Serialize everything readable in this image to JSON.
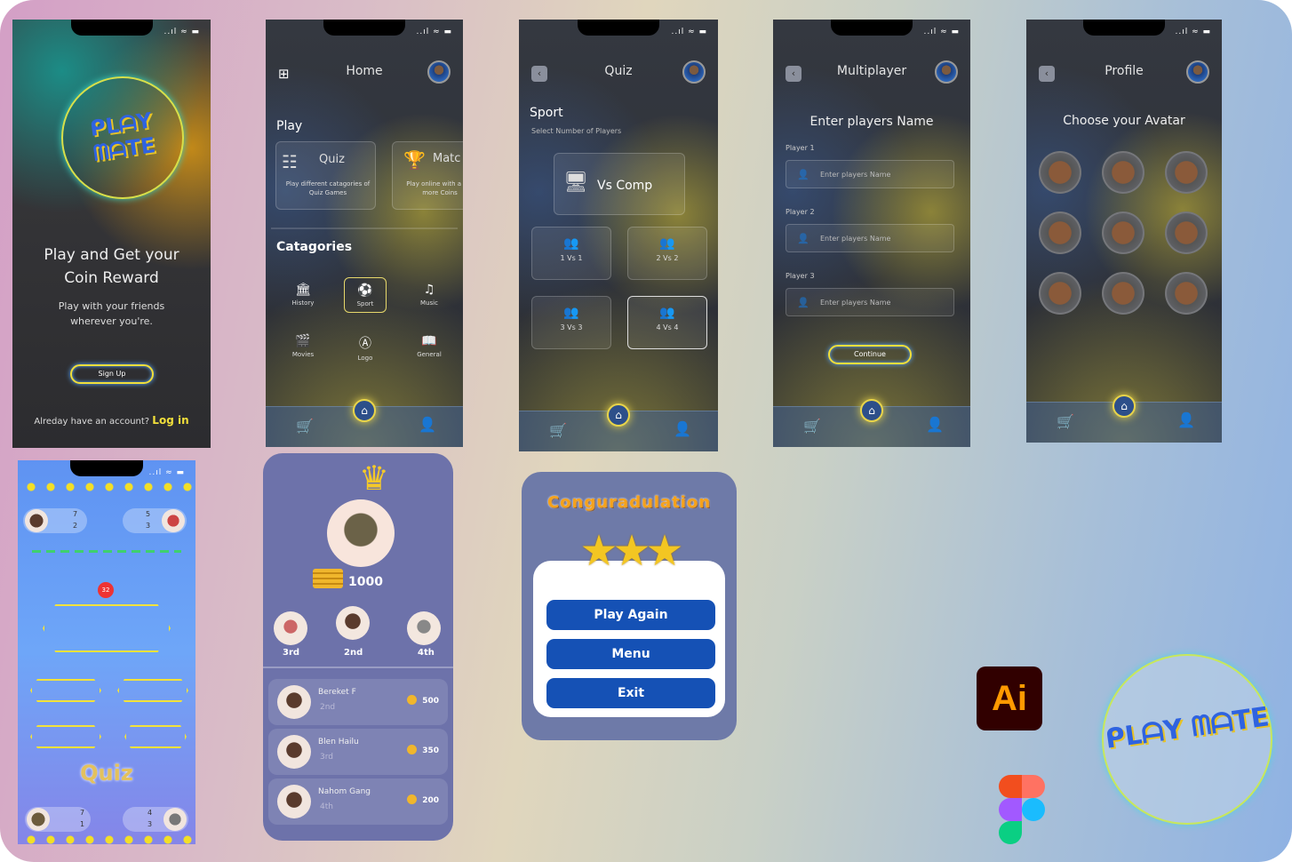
{
  "colors": {
    "accent": "#f1df3b",
    "primary_blue": "#1551b5",
    "glow_blue": "#58a8ff"
  },
  "status_bar": "..ıl ≈ ▬",
  "splash": {
    "logo_text": "ᑭᒪᗩY ᗰᗩTE",
    "headline": "Play and Get your Coin Reward",
    "sub": "Play with your friends wherever you're.",
    "signup": "Sign Up",
    "login_prompt": "Alreday have an account?",
    "login": "Log in"
  },
  "home": {
    "title": "Home",
    "play_title": "Play",
    "quiz_title": "Quiz",
    "quiz_desc": "Play different catagories of Quiz Games",
    "match_title": "Matc",
    "match_desc": "Play online with a get more Coins",
    "categories_title": "Catagories",
    "categories": [
      {
        "label": "History",
        "icon": "bank-icon"
      },
      {
        "label": "Sport",
        "icon": "basketball-icon"
      },
      {
        "label": "Music",
        "icon": "music-icon"
      },
      {
        "label": "Movies",
        "icon": "clapper-icon"
      },
      {
        "label": "Logo",
        "icon": "logo-icon"
      },
      {
        "label": "General",
        "icon": "book-icon"
      }
    ]
  },
  "quiz": {
    "title": "Quiz",
    "subject": "Sport",
    "sub": "Select Number of Players",
    "vs_comp": "Vs Comp",
    "modes": [
      "1 Vs 1",
      "2 Vs 2",
      "3 Vs 3",
      "4 Vs 4"
    ]
  },
  "multiplayer": {
    "title": "Multiplayer",
    "heading": "Enter players Name",
    "players": [
      {
        "label": "Player 1",
        "placeholder": "Enter players Name"
      },
      {
        "label": "Player 2",
        "placeholder": "Enter players Name"
      },
      {
        "label": "Player 3",
        "placeholder": "Enter players Name"
      }
    ],
    "continue": "Continue"
  },
  "profile": {
    "title": "Profile",
    "heading": "Choose your Avatar"
  },
  "game": {
    "p1": {
      "correct": "7",
      "wrong": "2"
    },
    "p2": {
      "correct": "5",
      "wrong": "3"
    },
    "timer": "32",
    "title": "Quiz",
    "p3": {
      "correct": "7",
      "wrong": "1"
    },
    "p4": {
      "correct": "4",
      "wrong": "3"
    }
  },
  "leaderboard": {
    "score": "1000",
    "podium": [
      "3rd",
      "2nd",
      "4th"
    ],
    "rows": [
      {
        "name": "Bereket F",
        "rank": "2nd",
        "coins": "500"
      },
      {
        "name": "Blen Hailu",
        "rank": "3rd",
        "coins": "350"
      },
      {
        "name": "Nahom Gang",
        "rank": "4th",
        "coins": "200"
      }
    ]
  },
  "result": {
    "title": "Conguradulation",
    "stars": "★★★",
    "play_again": "Play Again",
    "menu": "Menu",
    "exit": "Exit"
  },
  "tools": {
    "illustrator": "Ai"
  }
}
